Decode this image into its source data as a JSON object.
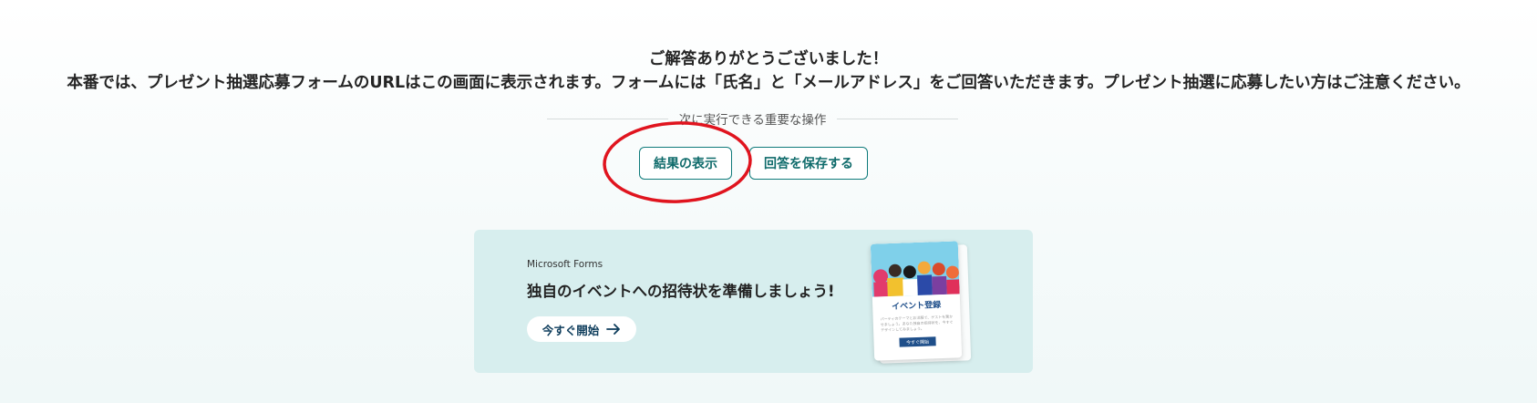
{
  "confirmation": {
    "line1": "ご解答ありがとうございました！",
    "line2": "本番では、プレゼント抽選応募フォームのURLはこの画面に表示されます。フォームには「氏名」と「メールアドレス」をご回答いただきます。プレゼント抽選に応募したい方はご注意ください。"
  },
  "actions": {
    "heading": "次に実行できる重要な操作",
    "view_results_label": "結果の表示",
    "save_response_label": "回答を保存する"
  },
  "promo": {
    "brand": "Microsoft Forms",
    "headline": "独自のイベントへの招待状を準備しましょう!",
    "start_label": "今すぐ開始",
    "card_title": "イベント登録",
    "card_text": "パーティのテーマとお洋服で、ゲストを驚かせましょう。あなた独自の招待状を、今すぐデザインしてみましょう。",
    "card_button": "今すぐ開始"
  },
  "colors": {
    "accent": "#0f7b7b",
    "banner_bg": "#d7eeee",
    "annotation": "#e0141e"
  },
  "icons": {
    "start_arrow": "arrow-right-icon"
  }
}
